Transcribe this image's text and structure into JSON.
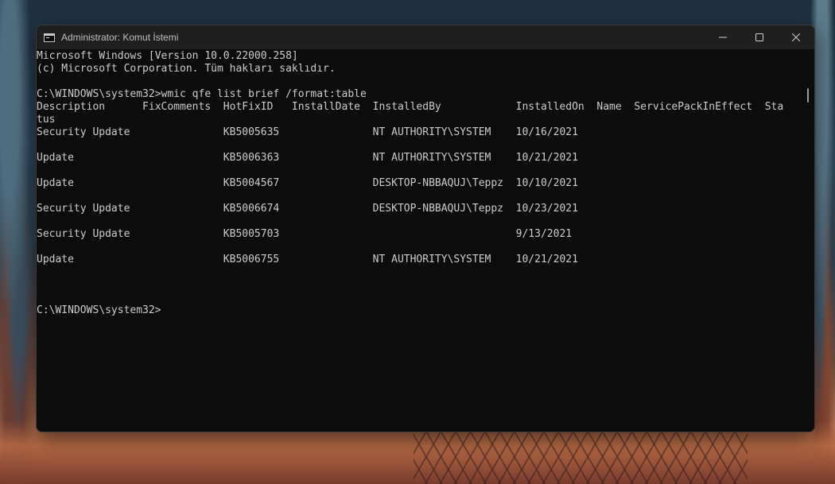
{
  "window": {
    "title": "Administrator: Komut İstemi",
    "icons": {
      "app": "cmd-icon",
      "minimize": "minimize-icon",
      "maximize": "maximize-icon",
      "close": "close-icon"
    }
  },
  "console": {
    "lines": [
      "Microsoft Windows [Version 10.0.22000.258]",
      "(c) Microsoft Corporation. Tüm hakları saklıdır.",
      "",
      "C:\\WINDOWS\\system32>wmic qfe list brief /format:table",
      "Description      FixComments  HotFixID   InstallDate  InstalledBy            InstalledOn  Name  ServicePackInEffect  Sta",
      "tus",
      "Security Update               KB5005635               NT AUTHORITY\\SYSTEM    10/16/2021",
      "",
      "Update                        KB5006363               NT AUTHORITY\\SYSTEM    10/21/2021",
      "",
      "Update                        KB5004567               DESKTOP-NBBAQUJ\\Teppz  10/10/2021",
      "",
      "Security Update               KB5006674               DESKTOP-NBBAQUJ\\Teppz  10/23/2021",
      "",
      "Security Update               KB5005703                                      9/13/2021",
      "",
      "Update                        KB5006755               NT AUTHORITY\\SYSTEM    10/21/2021",
      "",
      "",
      "",
      "C:\\WINDOWS\\system32>"
    ]
  }
}
